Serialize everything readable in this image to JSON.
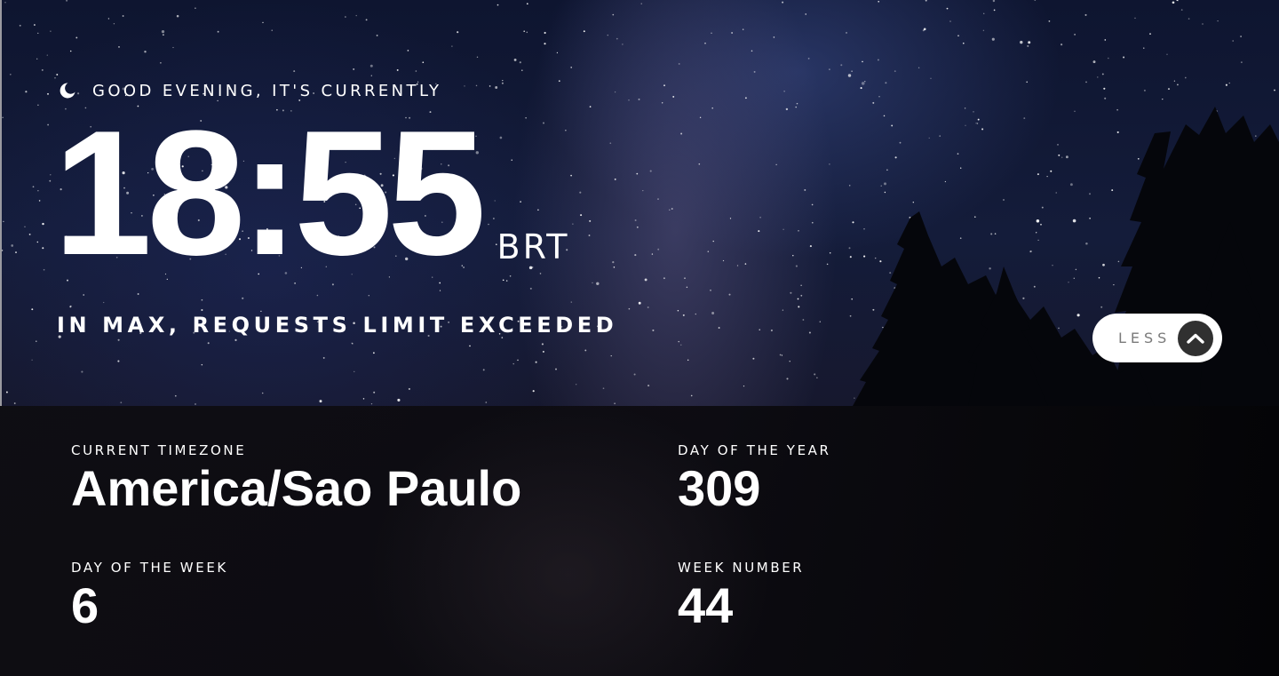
{
  "hero": {
    "greeting": "GOOD EVENING, IT'S CURRENTLY",
    "greeting_icon": "moon-icon",
    "time": "18:55",
    "timezone_abbr": "BRT",
    "location": "IN MAX, REQUESTS LIMIT EXCEEDED"
  },
  "toggle": {
    "label": "LESS",
    "icon": "chevron-up-icon"
  },
  "info": {
    "timezone": {
      "label": "CURRENT TIMEZONE",
      "value": "America/Sao Paulo"
    },
    "day_of_year": {
      "label": "DAY OF THE YEAR",
      "value": "309"
    },
    "day_of_week": {
      "label": "DAY OF THE WEEK",
      "value": "6"
    },
    "week_number": {
      "label": "WEEK NUMBER",
      "value": "44"
    }
  },
  "colors": {
    "text": "#ffffff",
    "button_bg": "#ffffff",
    "button_text": "#7a7a7a",
    "arrow_bg": "#303030",
    "panel_bg": "#0e0d12"
  }
}
